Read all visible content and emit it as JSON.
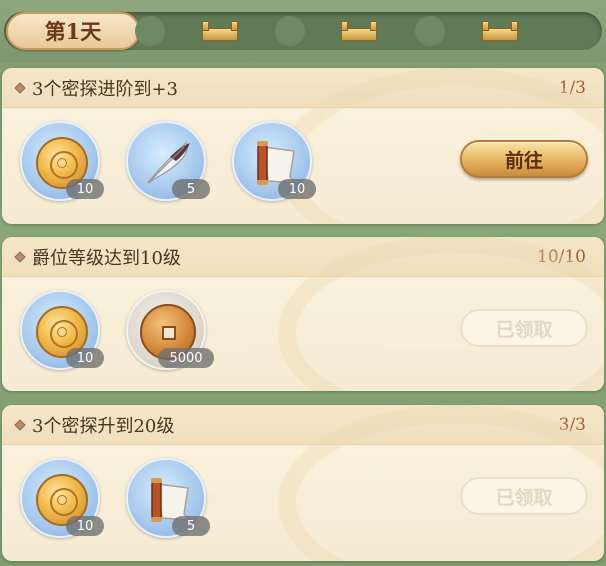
{
  "tabs": [
    {
      "label": "第1天",
      "active": true
    },
    {
      "label": "",
      "locked": true
    },
    {
      "label": "",
      "locked": true
    },
    {
      "label": "",
      "locked": true
    }
  ],
  "tasks": [
    {
      "title": "3个密探进阶到+3",
      "progress": "1/3",
      "rewards": [
        {
          "icon": "gold-coin-icon",
          "count": "10"
        },
        {
          "icon": "feather-quill-icon",
          "count": "5"
        },
        {
          "icon": "scroll-icon",
          "count": "10"
        }
      ],
      "button": {
        "label": "前往",
        "state": "go"
      }
    },
    {
      "title": "爵位等级达到10级",
      "progress": "10/10",
      "rewards": [
        {
          "icon": "gold-coin-icon",
          "count": "10"
        },
        {
          "icon": "copper-cash-coin-icon",
          "count": "5000"
        }
      ],
      "button": {
        "label": "已领取",
        "state": "claimed"
      }
    },
    {
      "title": "3个密探升到20级",
      "progress": "3/3",
      "rewards": [
        {
          "icon": "gold-coin-icon",
          "count": "10"
        },
        {
          "icon": "scroll-icon",
          "count": "5"
        }
      ],
      "button": {
        "label": "已领取",
        "state": "claimed"
      }
    }
  ],
  "colors": {
    "card_bg": "#fbf3df",
    "title_text": "#4d3322",
    "progress_text": "#a45e36",
    "tab_active": "#f8e8c8",
    "button_gold": "#e6b361"
  }
}
